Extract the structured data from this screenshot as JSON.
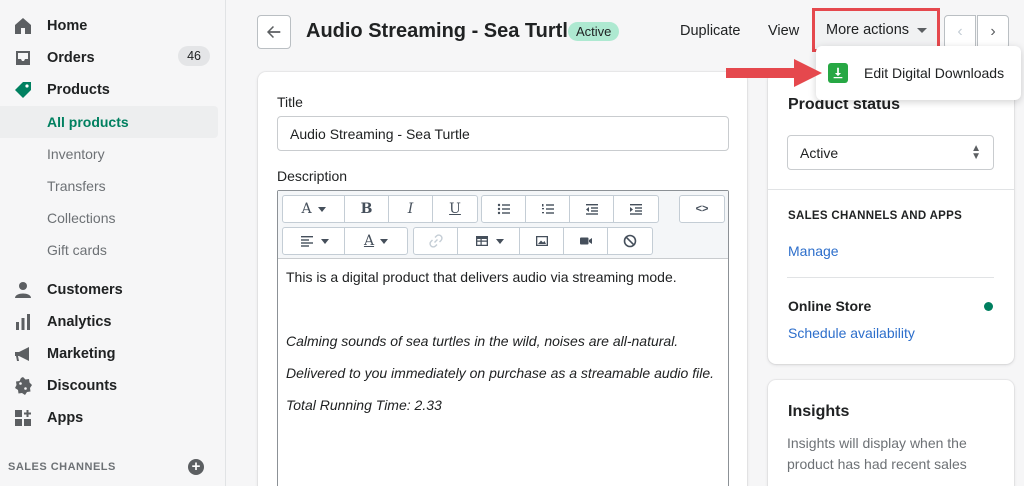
{
  "sidebar": {
    "items": [
      {
        "label": "Home",
        "icon": "home-icon"
      },
      {
        "label": "Orders",
        "icon": "orders-icon",
        "badge": "46"
      },
      {
        "label": "Products",
        "icon": "tag-icon"
      },
      {
        "label": "Customers",
        "icon": "person-icon"
      },
      {
        "label": "Analytics",
        "icon": "bar-chart-icon"
      },
      {
        "label": "Marketing",
        "icon": "megaphone-icon"
      },
      {
        "label": "Discounts",
        "icon": "discount-icon"
      },
      {
        "label": "Apps",
        "icon": "apps-icon"
      }
    ],
    "product_subitems": [
      "All products",
      "Inventory",
      "Transfers",
      "Collections",
      "Gift cards"
    ],
    "sales_channels_label": "SALES CHANNELS"
  },
  "header": {
    "title": "Audio Streaming - Sea Turtle",
    "status": "Active",
    "duplicate": "Duplicate",
    "view": "View",
    "more_actions": "More actions"
  },
  "popover": {
    "item": "Edit Digital Downloads",
    "icon": "download-icon"
  },
  "form": {
    "title_label": "Title",
    "title_value": "Audio Streaming - Sea Turtle",
    "description_label": "Description",
    "description_lines": [
      "This is a digital product that delivers audio via streaming mode.",
      "Calming sounds of sea turtles in the wild, noises are all-natural.",
      "Delivered to you immediately on purchase as a streamable audio file.",
      "Total Running Time: 2.33"
    ],
    "html_toggle": "<>"
  },
  "right_panel": {
    "product_status_title": "Product status",
    "status_value": "Active",
    "sales_channels_heading": "SALES CHANNELS AND APPS",
    "manage": "Manage",
    "online_store": "Online Store",
    "schedule": "Schedule availability",
    "insights_title": "Insights",
    "insights_text": "Insights will display when the product has had recent sales"
  },
  "colors": {
    "accent_green": "#008060",
    "highlight_red": "#e5484d",
    "link_blue": "#2c6ecb",
    "status_pill": "#aee9d1"
  }
}
